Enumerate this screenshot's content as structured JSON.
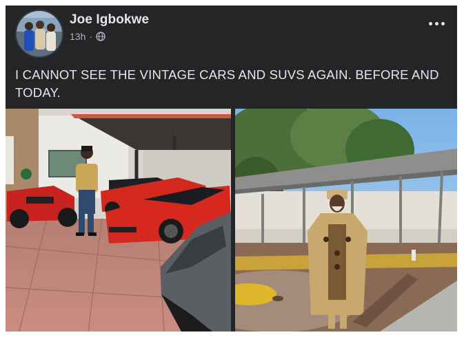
{
  "post": {
    "author": "Joe Igbokwe",
    "time": "13h",
    "separator": "·",
    "text": "I CANNOT SEE THE VINTAGE CARS AND SUVS AGAIN. BEFORE AND TODAY.",
    "privacy_icon": "globe-icon",
    "menu_icon": "more-options-icon"
  },
  "photos": [
    {
      "description_icon": "photo-before",
      "subject": "cars-under-carport"
    },
    {
      "description_icon": "photo-today",
      "subject": "man-in-empty-carport"
    }
  ],
  "colors": {
    "card_bg": "#242526",
    "text_primary": "#e4e6eb",
    "text_secondary": "#b0b3b8"
  }
}
